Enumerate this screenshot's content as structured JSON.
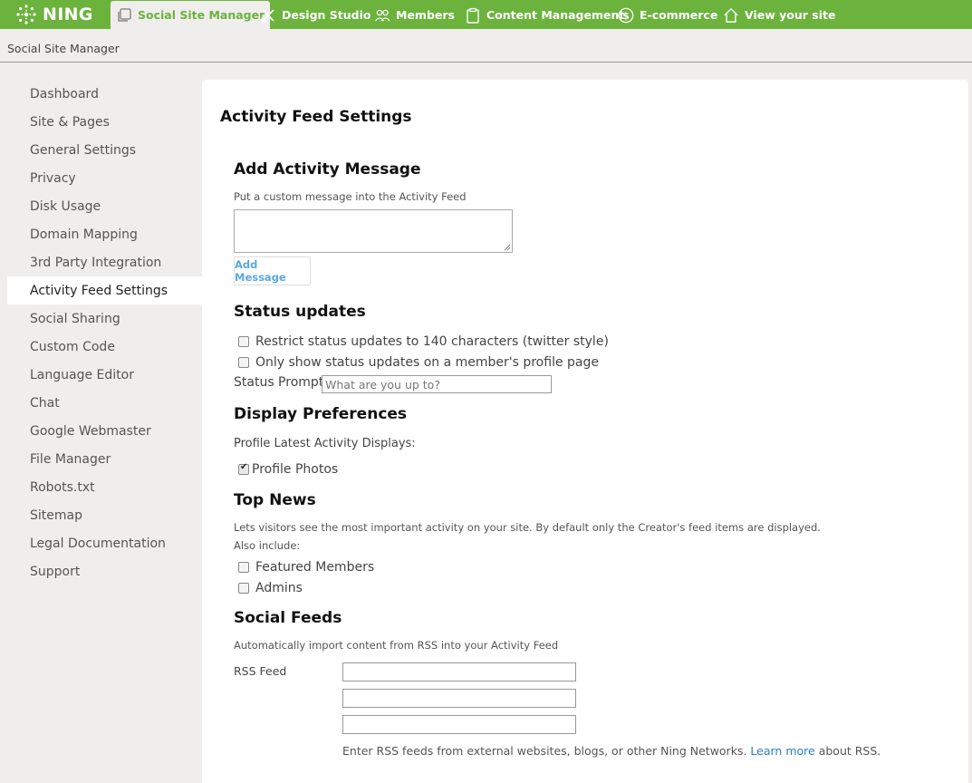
{
  "brand": {
    "name": "NING",
    "color": "#6bb33c"
  },
  "nav": {
    "tabs": [
      {
        "label": "Social Site Manager",
        "icon": "copy-icon"
      },
      {
        "label": "Design Studio",
        "icon": "tools-icon"
      },
      {
        "label": "Members",
        "icon": "users-icon"
      },
      {
        "label": "Content Management",
        "icon": "clipboard-icon"
      },
      {
        "label": "E-commerce",
        "icon": "dollar-icon"
      },
      {
        "label": "View your site",
        "icon": "home-icon"
      }
    ]
  },
  "breadcrumb": "Social Site Manager",
  "sidebar": {
    "items": [
      {
        "label": "Dashboard"
      },
      {
        "label": "Site & Pages"
      },
      {
        "label": "General Settings"
      },
      {
        "label": "Privacy"
      },
      {
        "label": "Disk Usage"
      },
      {
        "label": "Domain Mapping"
      },
      {
        "label": "3rd Party Integration"
      },
      {
        "label": "Activity Feed Settings"
      },
      {
        "label": "Social Sharing"
      },
      {
        "label": "Custom Code"
      },
      {
        "label": "Language Editor"
      },
      {
        "label": "Chat"
      },
      {
        "label": "Google Webmaster"
      },
      {
        "label": "File Manager"
      },
      {
        "label": "Robots.txt"
      },
      {
        "label": "Sitemap"
      },
      {
        "label": "Legal Documentation"
      },
      {
        "label": "Support"
      }
    ],
    "active": "Activity Feed Settings"
  },
  "main": {
    "title": "Activity Feed Settings",
    "add_message": {
      "heading": "Add Activity Message",
      "description": "Put a custom message into the Activity Feed",
      "value": "",
      "button": "Add Message"
    },
    "status_updates": {
      "heading": "Status updates",
      "options": [
        {
          "label": "Restrict status updates to 140 characters (twitter style)",
          "checked": false
        },
        {
          "label": "Only show status updates on a member's profile page",
          "checked": false
        }
      ],
      "prompt_label": "Status Prompt",
      "prompt_placeholder": "What are you up to?"
    },
    "display_preferences": {
      "heading": "Display Preferences",
      "subheading": "Profile Latest Activity Displays:",
      "options": [
        {
          "label": "Profile Photos",
          "checked": true
        }
      ]
    },
    "top_news": {
      "heading": "Top News",
      "description": "Lets visitors see the most important activity on your site. By default only the Creator's feed items are displayed.",
      "also_include": "Also include:",
      "options": [
        {
          "label": "Featured Members",
          "checked": false
        },
        {
          "label": "Admins",
          "checked": false
        }
      ]
    },
    "social_feeds": {
      "heading": "Social Feeds",
      "description": "Automatically import content from RSS into your Activity Feed",
      "rss_label": "RSS Feed",
      "rss_values": [
        "",
        "",
        ""
      ],
      "help_prefix": "Enter RSS feeds from external websites, blogs, or other Ning Networks.",
      "help_link": "Learn more",
      "help_suffix": "about RSS."
    }
  }
}
